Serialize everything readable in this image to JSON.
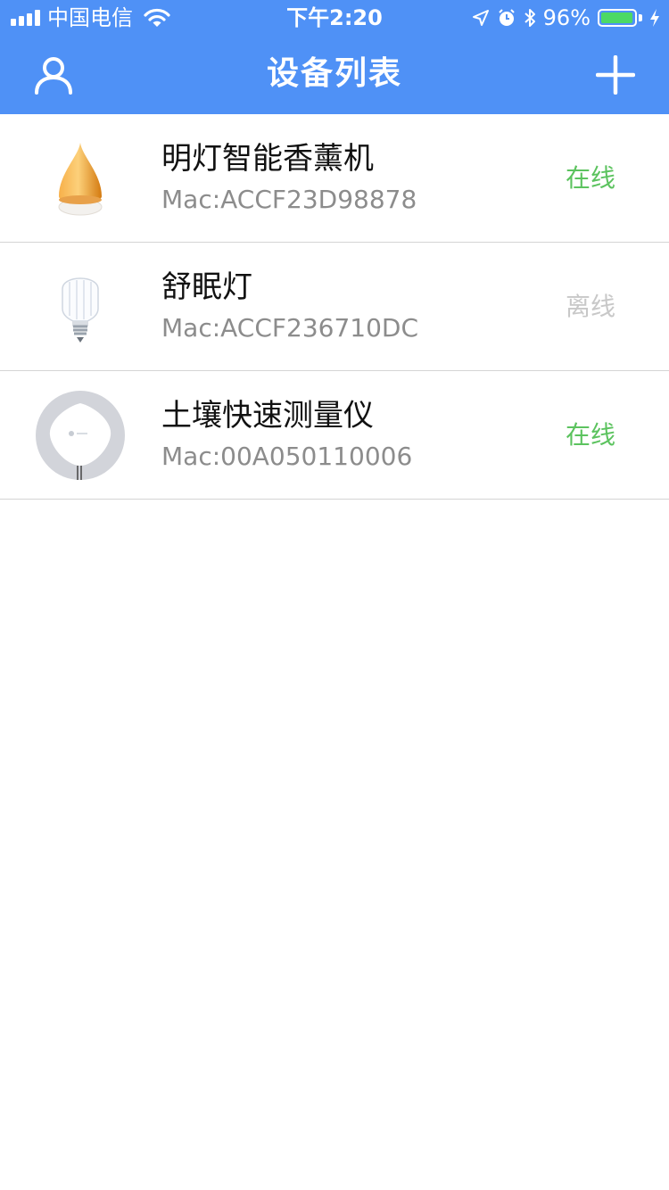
{
  "status_bar": {
    "carrier": "中国电信",
    "time": "下午2:20",
    "battery_percent": "96%",
    "battery_level": 0.96,
    "icons": [
      "signal-icon",
      "wifi-icon",
      "location-arrow-icon",
      "alarm-icon",
      "bluetooth-icon",
      "battery-icon",
      "charging-icon"
    ]
  },
  "header": {
    "title": "设备列表",
    "left_icon": "user-icon",
    "right_icon": "plus-icon"
  },
  "devices": [
    {
      "name": "明灯智能香薰机",
      "mac": "Mac:ACCF23D98878",
      "status": "在线",
      "status_color": "#5cc35f",
      "image": "aroma-diffuser-image"
    },
    {
      "name": "舒眠灯",
      "mac": "Mac:ACCF236710DC",
      "status": "离线",
      "status_color": "#c8c8c8",
      "image": "light-bulb-image"
    },
    {
      "name": "土壤快速测量仪",
      "mac": "Mac:00A050110006",
      "status": "在线",
      "status_color": "#5cc35f",
      "image": "soil-meter-image"
    }
  ],
  "colors": {
    "header_bg": "#4f91f6",
    "online": "#5cc35f",
    "offline": "#c8c8c8"
  }
}
